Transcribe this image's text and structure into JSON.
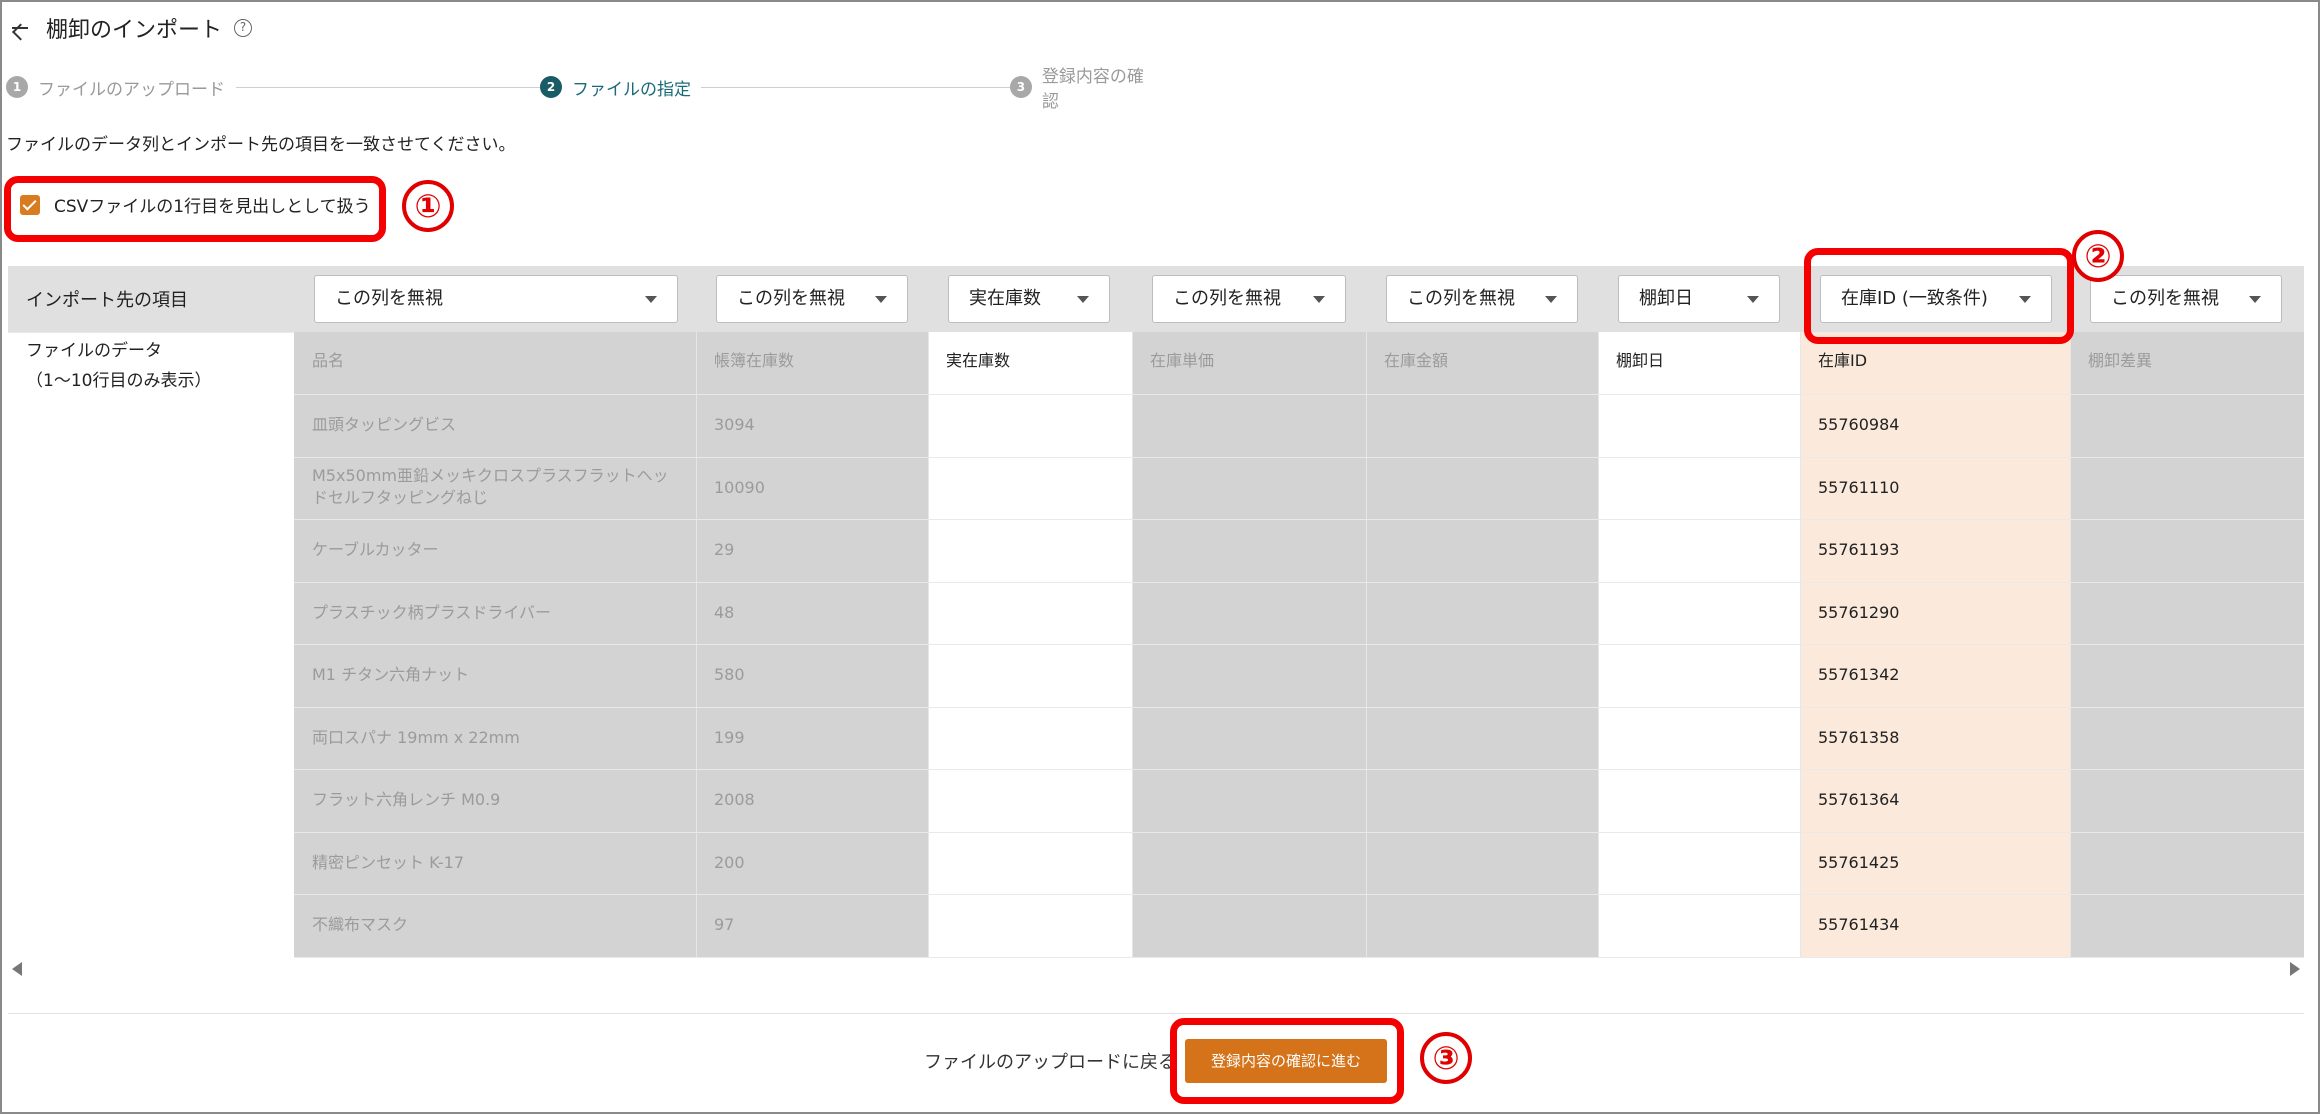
{
  "header": {
    "title": "棚卸のインポート",
    "help_icon": "?"
  },
  "stepper": [
    {
      "num": "1",
      "label": "ファイルのアップロード",
      "state": "inactive"
    },
    {
      "num": "2",
      "label": "ファイルの指定",
      "state": "active"
    },
    {
      "num": "3",
      "label": "登録内容の確認",
      "state": "inactive"
    }
  ],
  "instruction": "ファイルのデータ列とインポート先の項目を一致させてください。",
  "checkbox": {
    "label": "CSVファイルの1行目を見出しとして扱う",
    "checked": true
  },
  "table": {
    "target_label": "インポート先の項目",
    "file_label_line1": "ファイルのデータ",
    "file_label_line2": "（1〜10行目のみ表示）",
    "columns": [
      {
        "select": "この列を無視",
        "header": "品名",
        "values": [
          "皿頭タッピングビス",
          "M5x50mm亜鉛メッキクロスプラスフラットヘッドセルフタッピングねじ",
          "ケーブルカッター",
          "プラスチック柄プラスドライバー",
          "M1 チタン六角ナット",
          "両口スパナ 19mm x 22mm",
          "フラット六角レンチ M0.9",
          "精密ピンセット K-17",
          "不織布マスク"
        ]
      },
      {
        "select": "この列を無視",
        "header": "帳簿在庫数",
        "values": [
          "3094",
          "10090",
          "29",
          "48",
          "580",
          "199",
          "2008",
          "200",
          "97"
        ]
      },
      {
        "select": "実在庫数",
        "header": "実在庫数",
        "values": [
          "",
          "",
          "",
          "",
          "",
          "",
          "",
          "",
          ""
        ]
      },
      {
        "select": "この列を無視",
        "header": "在庫単価",
        "values": [
          "",
          "",
          "",
          "",
          "",
          "",
          "",
          "",
          ""
        ]
      },
      {
        "select": "この列を無視",
        "header": "在庫金額",
        "values": [
          "",
          "",
          "",
          "",
          "",
          "",
          "",
          "",
          ""
        ]
      },
      {
        "select": "棚卸日",
        "header": "棚卸日",
        "values": [
          "",
          "",
          "",
          "",
          "",
          "",
          "",
          "",
          ""
        ]
      },
      {
        "select": "在庫ID (一致条件)",
        "header": "在庫ID",
        "values": [
          "55760984",
          "55761110",
          "55761193",
          "55761290",
          "55761342",
          "55761358",
          "55761364",
          "55761425",
          "55761434"
        ]
      },
      {
        "select": "この列を無視",
        "header": "棚卸差異",
        "values": [
          "",
          "",
          "",
          "",
          "",
          "",
          "",
          "",
          ""
        ]
      }
    ]
  },
  "annotations": [
    "①",
    "②",
    "③"
  ],
  "footer": {
    "back_label": "ファイルのアップロードに戻る",
    "next_label": "登録内容の確認に進む"
  },
  "colors": {
    "accent": "#d4731a",
    "active_step": "#1a5c66",
    "annotation": "#f50000",
    "highlight": "#fbeadc"
  }
}
